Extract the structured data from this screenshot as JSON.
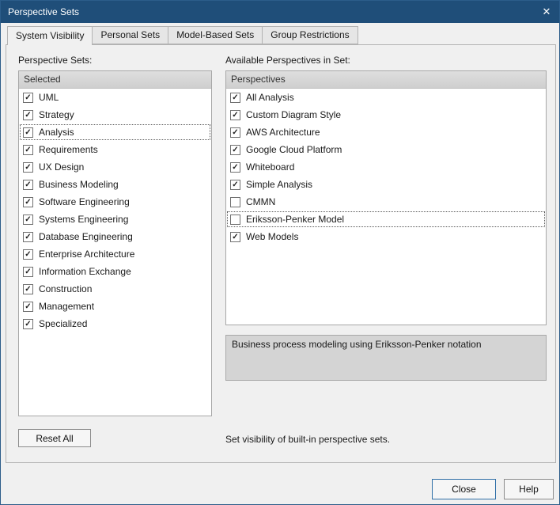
{
  "window": {
    "title": "Perspective Sets"
  },
  "glyphs": {
    "close": "✕",
    "check": "✓"
  },
  "tabs": [
    {
      "label": "System Visibility",
      "active": true
    },
    {
      "label": "Personal Sets"
    },
    {
      "label": "Model-Based Sets"
    },
    {
      "label": "Group Restrictions"
    }
  ],
  "left_panel": {
    "label": "Perspective Sets:",
    "header": "Selected",
    "items": [
      {
        "label": "UML",
        "checked": true
      },
      {
        "label": "Strategy",
        "checked": true
      },
      {
        "label": "Analysis",
        "checked": true,
        "focused": true
      },
      {
        "label": "Requirements",
        "checked": true
      },
      {
        "label": "UX Design",
        "checked": true
      },
      {
        "label": "Business Modeling",
        "checked": true
      },
      {
        "label": "Software Engineering",
        "checked": true
      },
      {
        "label": "Systems Engineering",
        "checked": true
      },
      {
        "label": "Database Engineering",
        "checked": true
      },
      {
        "label": "Enterprise Architecture",
        "checked": true
      },
      {
        "label": "Information Exchange",
        "checked": true
      },
      {
        "label": "Construction",
        "checked": true
      },
      {
        "label": "Management",
        "checked": true
      },
      {
        "label": "Specialized",
        "checked": true
      }
    ],
    "reset_button": "Reset All"
  },
  "right_panel": {
    "label": "Available Perspectives in Set:",
    "header": "Perspectives",
    "items": [
      {
        "label": "All Analysis",
        "checked": true
      },
      {
        "label": "Custom Diagram Style",
        "checked": true
      },
      {
        "label": "AWS Architecture",
        "checked": true
      },
      {
        "label": "Google Cloud Platform",
        "checked": true
      },
      {
        "label": "Whiteboard",
        "checked": true
      },
      {
        "label": "Simple Analysis",
        "checked": true
      },
      {
        "label": "CMMN",
        "checked": false
      },
      {
        "label": "Eriksson-Penker Model",
        "checked": false,
        "focused": true
      },
      {
        "label": "Web Models",
        "checked": true
      }
    ],
    "description": "Business process modeling using Eriksson-Penker notation"
  },
  "footer": {
    "hint": "Set visibility of built-in perspective sets.",
    "close_button": "Close",
    "help_button": "Help"
  },
  "colors": {
    "titlebar": "#1f4e79",
    "default_button_border": "#2f6fa7"
  }
}
